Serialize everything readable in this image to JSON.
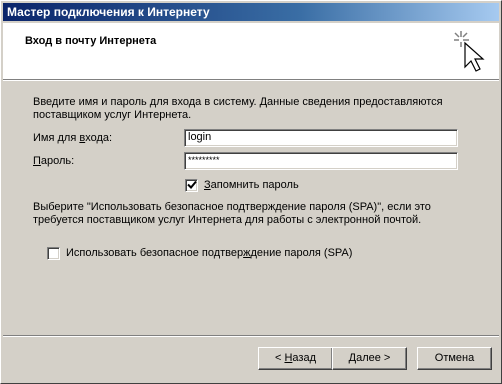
{
  "window": {
    "title": "Мастер подключения к Интернету"
  },
  "header": {
    "title": "Вход в почту Интернета",
    "icon": "wizard-sparkle-cursor-icon"
  },
  "intro": {
    "line1": "Введите имя и пароль для входа в систему. Данные сведения предоставляются",
    "line2": "поставщиком услуг Интернета."
  },
  "fields": {
    "username": {
      "label_pre": "Имя для ",
      "label_mnemonic": "в",
      "label_post": "хода:",
      "value": "login"
    },
    "password": {
      "label_mnemonic": "П",
      "label_post": "ароль:",
      "value": "*********"
    }
  },
  "remember": {
    "label_mnemonic": "З",
    "label_post": "апомнить пароль",
    "checked": true
  },
  "spa_info": {
    "line1": "Выберите \"Использовать безопасное подтверждение пароля (SPA)\", если это",
    "line2": "требуется поставщиком услуг Интернета для работы с электронной почтой."
  },
  "spa_checkbox": {
    "label_pre": "Использовать безопасное подтвер",
    "label_mnemonic": "ж",
    "label_post": "дение пароля (SPA)",
    "checked": false
  },
  "buttons": {
    "back_prefix": "< ",
    "back_mnemonic": "Н",
    "back_post": "азад",
    "next": "Далее >",
    "cancel": "Отмена"
  }
}
